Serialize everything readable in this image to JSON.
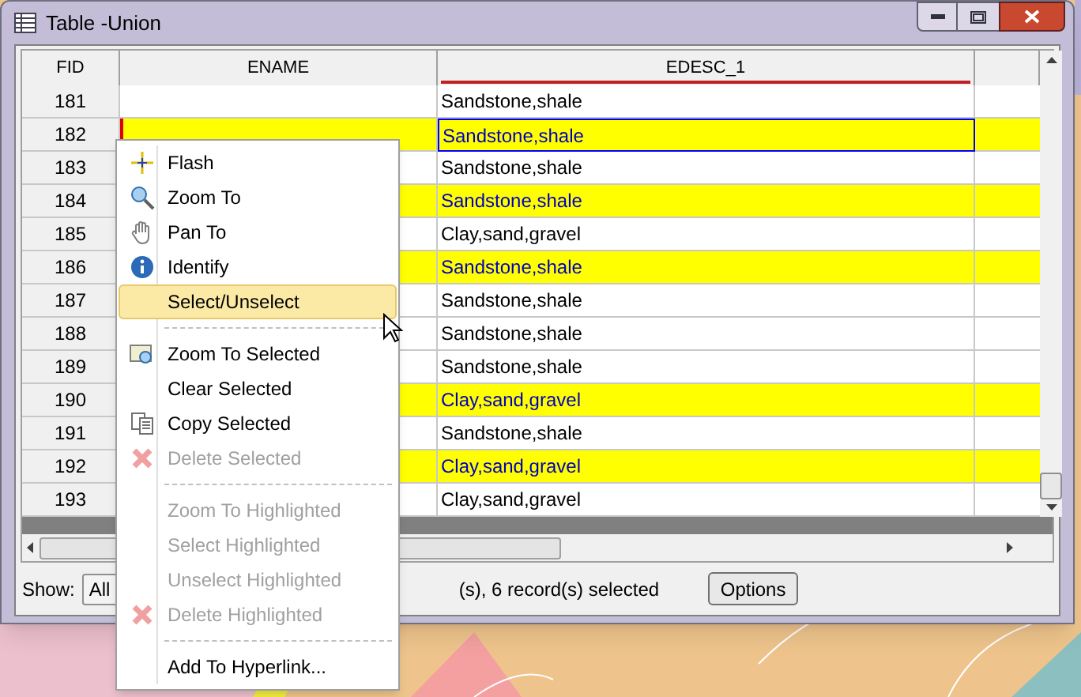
{
  "window": {
    "title": "Table -Union"
  },
  "table": {
    "columns": [
      {
        "label": "FID",
        "sorted": false
      },
      {
        "label": "ENAME",
        "sorted": false
      },
      {
        "label": "EDESC_1",
        "sorted": true
      },
      {
        "sorted": false
      }
    ],
    "rows": [
      {
        "fid": "181",
        "edesc": "Sandstone,shale",
        "selected": false,
        "focused": false
      },
      {
        "fid": "182",
        "edesc": "Sandstone,shale",
        "selected": true,
        "focused": true
      },
      {
        "fid": "183",
        "edesc": "Sandstone,shale",
        "selected": false,
        "focused": false
      },
      {
        "fid": "184",
        "edesc": "Sandstone,shale",
        "selected": true,
        "focused": false
      },
      {
        "fid": "185",
        "edesc": "Clay,sand,gravel",
        "selected": false,
        "focused": false
      },
      {
        "fid": "186",
        "edesc": "Sandstone,shale",
        "selected": true,
        "focused": false
      },
      {
        "fid": "187",
        "edesc": "Sandstone,shale",
        "selected": false,
        "focused": false
      },
      {
        "fid": "188",
        "edesc": "Sandstone,shale",
        "selected": false,
        "focused": false
      },
      {
        "fid": "189",
        "edesc": "Sandstone,shale",
        "selected": false,
        "focused": false
      },
      {
        "fid": "190",
        "edesc": "Clay,sand,gravel",
        "selected": true,
        "focused": false
      },
      {
        "fid": "191",
        "edesc": "Sandstone,shale",
        "selected": false,
        "focused": false
      },
      {
        "fid": "192",
        "edesc": "Clay,sand,gravel",
        "selected": true,
        "focused": false
      },
      {
        "fid": "193",
        "edesc": "Clay,sand,gravel",
        "selected": false,
        "focused": false
      }
    ]
  },
  "status_bar": {
    "show_label": "Show:",
    "show_value": "All",
    "record_text": "(s), 6 record(s) selected",
    "options_button": "Options"
  },
  "context_menu": [
    {
      "kind": "item",
      "label": "Flash",
      "disabled": false,
      "selected": false
    },
    {
      "kind": "item",
      "label": "Zoom To",
      "disabled": false,
      "selected": false
    },
    {
      "kind": "item",
      "label": "Pan To",
      "disabled": false,
      "selected": false
    },
    {
      "kind": "item",
      "label": "Identify",
      "disabled": false,
      "selected": false
    },
    {
      "kind": "item",
      "label": "Select/Unselect",
      "disabled": false,
      "selected": true
    },
    {
      "kind": "separator"
    },
    {
      "kind": "item",
      "label": "Zoom To Selected",
      "disabled": false,
      "selected": false
    },
    {
      "kind": "item",
      "label": "Clear Selected",
      "disabled": false,
      "selected": false
    },
    {
      "kind": "item",
      "label": "Copy Selected",
      "disabled": false,
      "selected": false
    },
    {
      "kind": "item",
      "label": "Delete Selected",
      "disabled": true,
      "selected": false
    },
    {
      "kind": "separator"
    },
    {
      "kind": "item",
      "label": "Zoom To Highlighted",
      "disabled": true,
      "selected": false
    },
    {
      "kind": "item",
      "label": "Select Highlighted",
      "disabled": true,
      "selected": false
    },
    {
      "kind": "item",
      "label": "Unselect Highlighted",
      "disabled": true,
      "selected": false
    },
    {
      "kind": "item",
      "label": "Delete Highlighted",
      "disabled": true,
      "selected": false
    },
    {
      "kind": "separator"
    },
    {
      "kind": "item",
      "label": "Add To Hyperlink...",
      "disabled": false,
      "selected": false
    }
  ]
}
